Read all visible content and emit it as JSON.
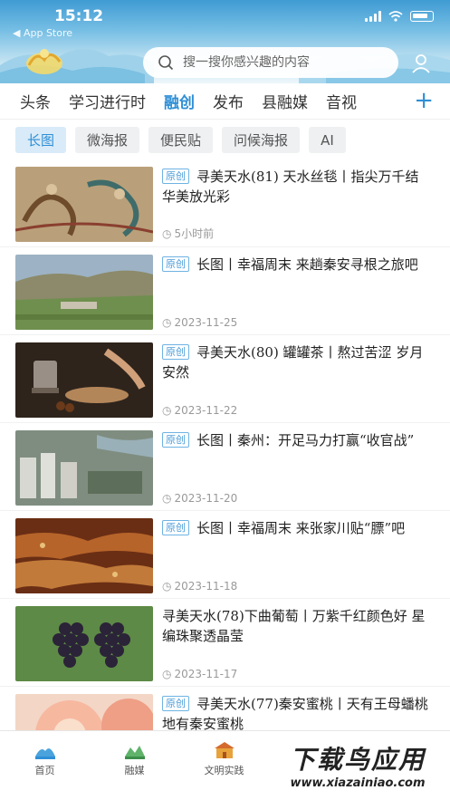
{
  "status_bar": {
    "time": "15:12",
    "back_label": "◀ App Store"
  },
  "header": {
    "search_placeholder": "搜一搜你感兴趣的内容",
    "logo_icon": "tianshui-logo",
    "user_icon": "user-icon"
  },
  "channels": {
    "items": [
      "头条",
      "学习进行时",
      "融创",
      "发布",
      "县融媒",
      "音视"
    ],
    "active": "融创",
    "add_label": "+"
  },
  "sub_tabs": {
    "items": [
      "长图",
      "微海报",
      "便民贴",
      "问候海报",
      "AI"
    ],
    "active": "长图"
  },
  "articles": [
    {
      "badge": "原创",
      "title": "寻美天水(81) 天水丝毯丨指尖万千结 华美放光彩",
      "time": "5小时前"
    },
    {
      "badge": "原创",
      "title": "长图丨幸福周末 来趟秦安寻根之旅吧",
      "time": "2023-11-25"
    },
    {
      "badge": "原创",
      "title": "寻美天水(80) 罐罐茶丨熬过苦涩 岁月安然",
      "time": "2023-11-22"
    },
    {
      "badge": "原创",
      "title": "长图丨秦州：开足马力打赢“收官战”",
      "time": "2023-11-20"
    },
    {
      "badge": "原创",
      "title": "长图丨幸福周末 来张家川贴“膘”吧",
      "time": "2023-11-18"
    },
    {
      "badge": "",
      "title": "寻美天水(78)下曲葡萄丨万紫千红颜色好 星编珠聚透晶莹",
      "time": "2023-11-17"
    },
    {
      "badge": "原创",
      "title": "寻美天水(77)秦安蜜桃丨天有王母蟠桃 地有秦安蜜桃",
      "time": ""
    }
  ],
  "bottom_nav": {
    "items": [
      {
        "label": "首页",
        "icon": "home-icon"
      },
      {
        "label": "融媒",
        "icon": "media-icon"
      },
      {
        "label": "文明实践",
        "icon": "civilization-icon"
      }
    ]
  },
  "watermark": {
    "main": "下载鸟应用",
    "url": "www.xiazainiao.com"
  },
  "colors": {
    "accent": "#2f8fd6",
    "header_top": "#3f9bd3",
    "badge": "#4a9bd8"
  }
}
